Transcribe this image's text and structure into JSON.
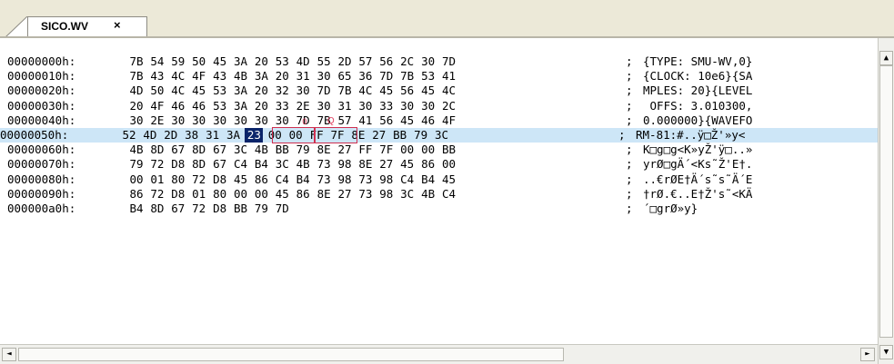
{
  "tab": {
    "label": "SICO.WV",
    "close": "×"
  },
  "rows": [
    {
      "addr": "00000000h:",
      "bytes": [
        "7B",
        "54",
        "59",
        "50",
        "45",
        "3A",
        "20",
        "53",
        "4D",
        "55",
        "2D",
        "57",
        "56",
        "2C",
        "30",
        "7D"
      ],
      "sep": ";",
      "ascii": "{TYPE: SMU-WV,0}"
    },
    {
      "addr": "00000010h:",
      "bytes": [
        "7B",
        "43",
        "4C",
        "4F",
        "43",
        "4B",
        "3A",
        "20",
        "31",
        "30",
        "65",
        "36",
        "7D",
        "7B",
        "53",
        "41"
      ],
      "sep": ";",
      "ascii": "{CLOCK: 10e6}{SA"
    },
    {
      "addr": "00000020h:",
      "bytes": [
        "4D",
        "50",
        "4C",
        "45",
        "53",
        "3A",
        "20",
        "32",
        "30",
        "7D",
        "7B",
        "4C",
        "45",
        "56",
        "45",
        "4C"
      ],
      "sep": ";",
      "ascii": "MPLES: 20}{LEVEL"
    },
    {
      "addr": "00000030h:",
      "bytes": [
        "20",
        "4F",
        "46",
        "46",
        "53",
        "3A",
        "20",
        "33",
        "2E",
        "30",
        "31",
        "30",
        "33",
        "30",
        "30",
        "2C"
      ],
      "sep": ";",
      "ascii": " OFFS: 3.010300,"
    },
    {
      "addr": "00000040h:",
      "bytes": [
        "30",
        "2E",
        "30",
        "30",
        "30",
        "30",
        "30",
        "30",
        "7D",
        "7B",
        "57",
        "41",
        "56",
        "45",
        "46",
        "4F"
      ],
      "sep": ";",
      "ascii": "0.000000}{WAVEFO"
    },
    {
      "addr": "00000050h:",
      "bytes": [
        "52",
        "4D",
        "2D",
        "38",
        "31",
        "3A",
        "23",
        "00",
        "00",
        "FF",
        "7F",
        "8E",
        "27",
        "BB",
        "79",
        "3C"
      ],
      "sep": ";",
      "ascii": "RM-81:#..ÿ□Ž'»y<",
      "highlight": true,
      "cursor_byte": 6
    },
    {
      "addr": "00000060h:",
      "bytes": [
        "4B",
        "8D",
        "67",
        "8D",
        "67",
        "3C",
        "4B",
        "BB",
        "79",
        "8E",
        "27",
        "FF",
        "7F",
        "00",
        "00",
        "BB"
      ],
      "sep": ";",
      "ascii": "K□g□g<K»yŽ'ÿ□..»"
    },
    {
      "addr": "00000070h:",
      "bytes": [
        "79",
        "72",
        "D8",
        "8D",
        "67",
        "C4",
        "B4",
        "3C",
        "4B",
        "73",
        "98",
        "8E",
        "27",
        "45",
        "86",
        "00"
      ],
      "sep": ";",
      "ascii": "yrØ□gÄ´<Ks˜Ž'E†."
    },
    {
      "addr": "00000080h:",
      "bytes": [
        "00",
        "01",
        "80",
        "72",
        "D8",
        "45",
        "86",
        "C4",
        "B4",
        "73",
        "98",
        "73",
        "98",
        "C4",
        "B4",
        "45"
      ],
      "sep": ";",
      "ascii": "..€rØE†Ä´s˜s˜Ä´E"
    },
    {
      "addr": "00000090h:",
      "bytes": [
        "86",
        "72",
        "D8",
        "01",
        "80",
        "00",
        "00",
        "45",
        "86",
        "8E",
        "27",
        "73",
        "98",
        "3C",
        "4B",
        "C4"
      ],
      "sep": ";",
      "ascii": "†rØ.€..E†Ž's˜<KÄ"
    },
    {
      "addr": "000000a0h:",
      "bytes": [
        "B4",
        "8D",
        "67",
        "72",
        "D8",
        "BB",
        "79",
        "7D"
      ],
      "sep": ";",
      "ascii": "´□grØ»y}"
    }
  ],
  "annotation_marks": [
    "0",
    "Q"
  ],
  "scroll": {
    "up": "▲",
    "down": "▼",
    "left": "◄",
    "right": "►"
  }
}
